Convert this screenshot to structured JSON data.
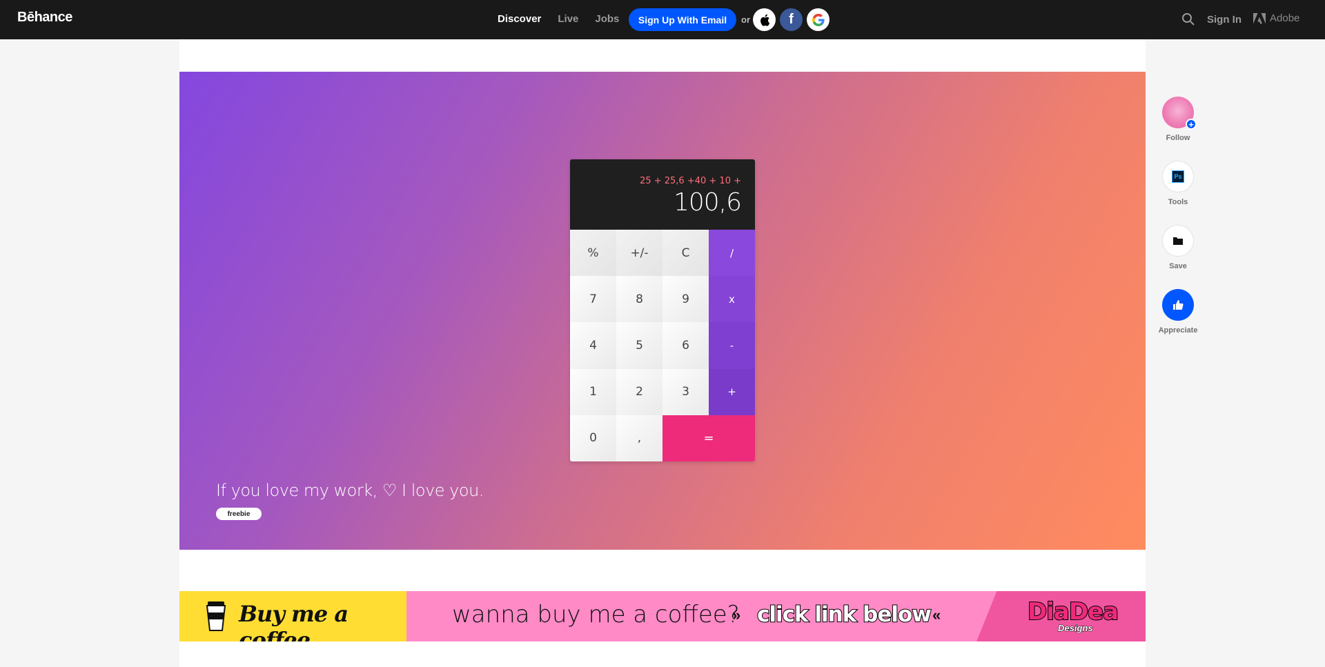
{
  "nav": {
    "logo": "Bēhance",
    "links": [
      "Discover",
      "Live",
      "Jobs"
    ],
    "signup_label": "Sign Up With Email",
    "or_text": "or",
    "signin_label": "Sign In",
    "adobe_label": "Adobe"
  },
  "calculator": {
    "expression": "25 + 25,6 +40 + 10 +",
    "result": "100,6",
    "keys": [
      "%",
      "+/-",
      "C",
      "/",
      "7",
      "8",
      "9",
      "x",
      "4",
      "5",
      "6",
      "-",
      "1",
      "2",
      "3",
      "+",
      "0",
      ",",
      "="
    ]
  },
  "project": {
    "tagline": "If you love my work, ♡ I love you.",
    "tag": "freebie"
  },
  "banner": {
    "coffee_text": "Buy me a coffee",
    "wanna_text": "wanna buy me a coffee?",
    "arrows_left": "»",
    "click_text": "click link below",
    "arrows_right": "«",
    "brand_main": "DiaDea",
    "brand_sub": "Designs"
  },
  "sidebar": {
    "follow": "Follow",
    "tools": "Tools",
    "save": "Save",
    "appreciate": "Appreciate",
    "tool_badge": "Ps"
  },
  "colors": {
    "nav_bg": "#191919",
    "accent_blue": "#0057ff",
    "equals_pink": "#ee2a7b",
    "operator_purple": "#8a48dc"
  }
}
